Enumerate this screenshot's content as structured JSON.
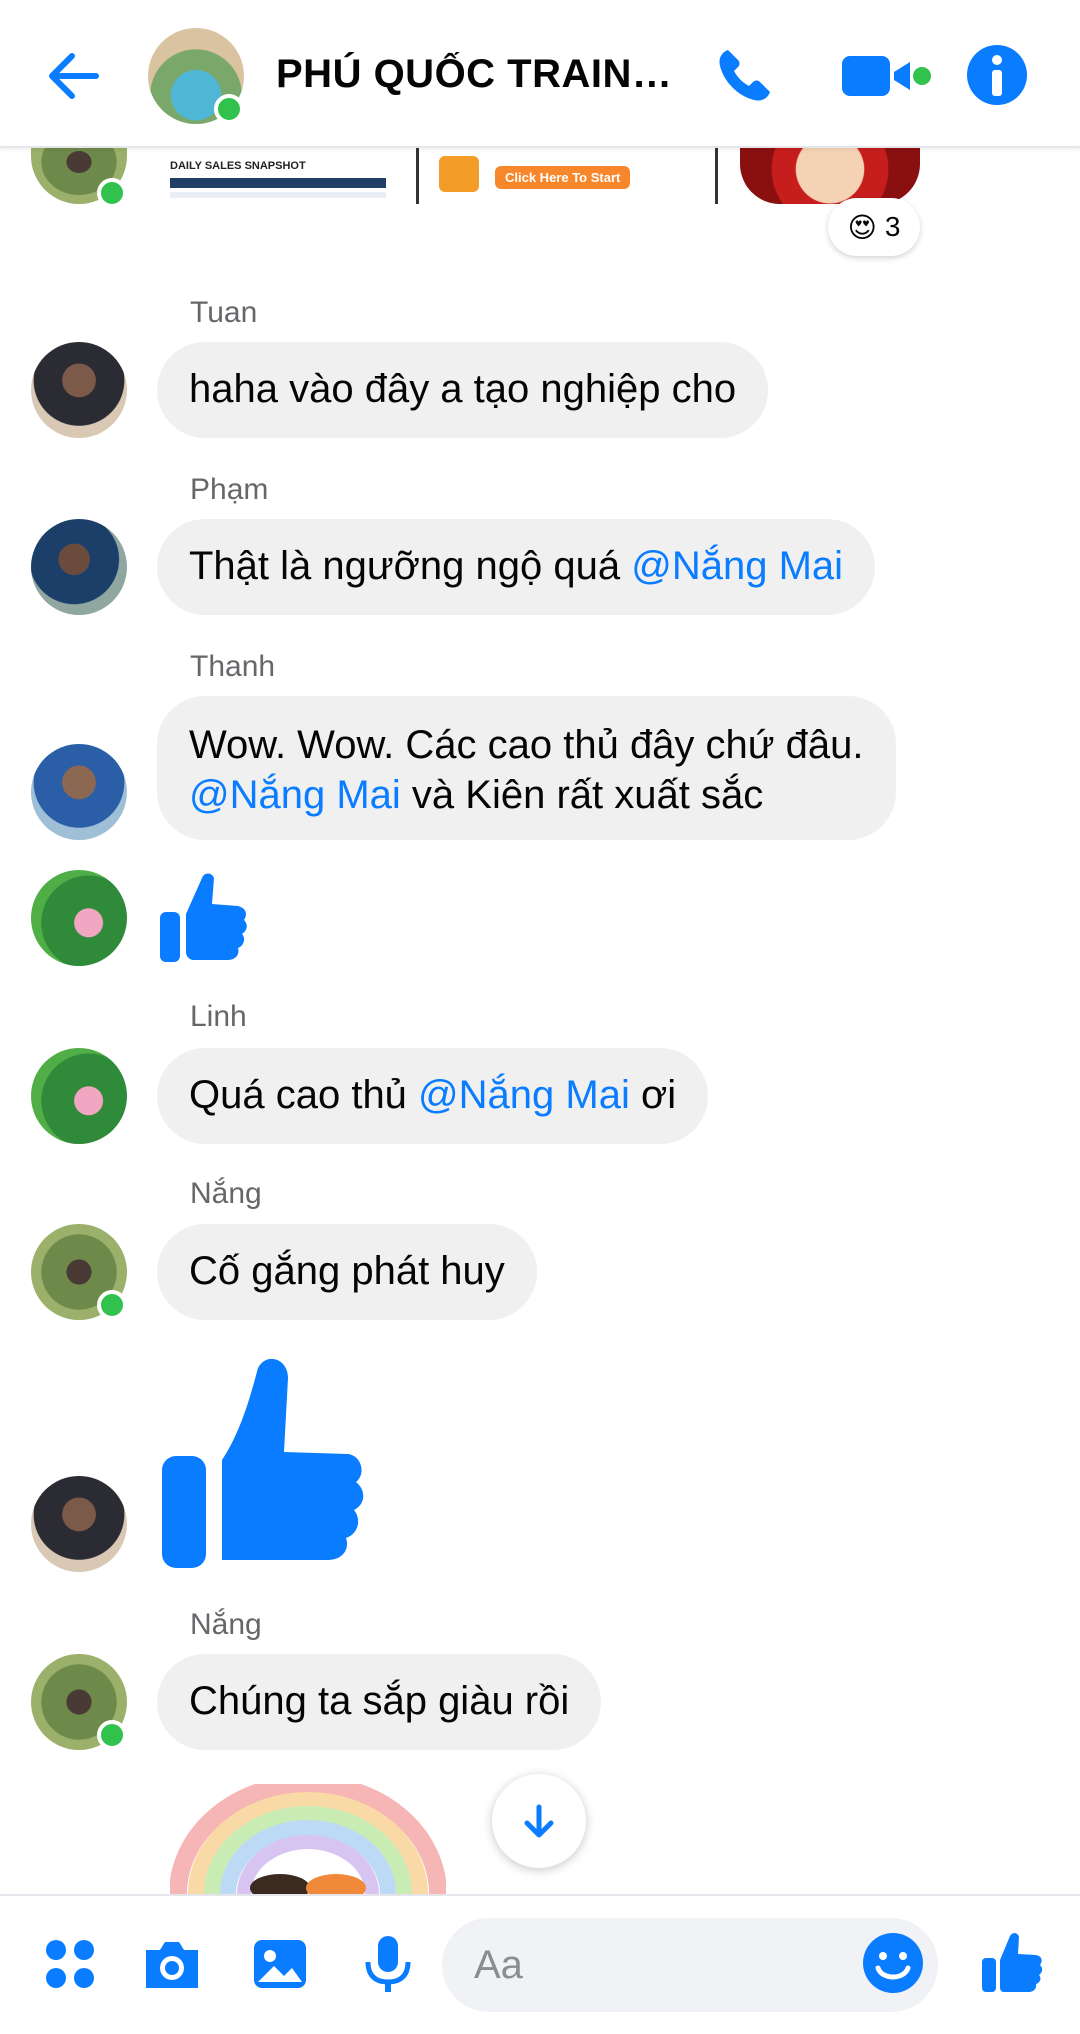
{
  "header": {
    "title": "PHÚ QUỐC TRAINI...",
    "icons": [
      "back-arrow-icon",
      "phone-icon",
      "video-camera-icon",
      "info-icon"
    ]
  },
  "reaction": {
    "emoji": "😍",
    "count": "3"
  },
  "strip": {
    "snapshot_title": "DAILY SALES SNAPSHOT",
    "cta": "Click Here To Start"
  },
  "messages": [
    {
      "sender": "Tuan",
      "text": "haha vào đây a tạo nghiệp cho"
    },
    {
      "sender": "Phạm",
      "text_before": "Thật là ngưỡng ngộ quá ",
      "mention": "@Nắng Mai"
    },
    {
      "sender": "Thanh",
      "line1": "Wow. Wow. Các cao thủ đây chứ đâu.",
      "mention": "@Nắng Mai",
      "line2_after": " và Kiên rất xuất sắc"
    },
    {
      "sender": "Linh",
      "text_before": "Quá cao thủ ",
      "mention": "@Nắng Mai",
      "text_after": " ơi"
    },
    {
      "sender": "Nắng",
      "text": "Cố gắng phát huy"
    },
    {
      "sender": "Nắng",
      "text": "Chúng ta sắp giàu rồi"
    }
  ],
  "composer": {
    "placeholder": "Aa",
    "icons": [
      "apps-icon",
      "camera-icon",
      "gallery-icon",
      "microphone-icon",
      "emoji-icon",
      "like-icon"
    ]
  },
  "colors": {
    "accent": "#0a7cff",
    "online": "#31c24d",
    "bubble": "#f0f0f0"
  }
}
